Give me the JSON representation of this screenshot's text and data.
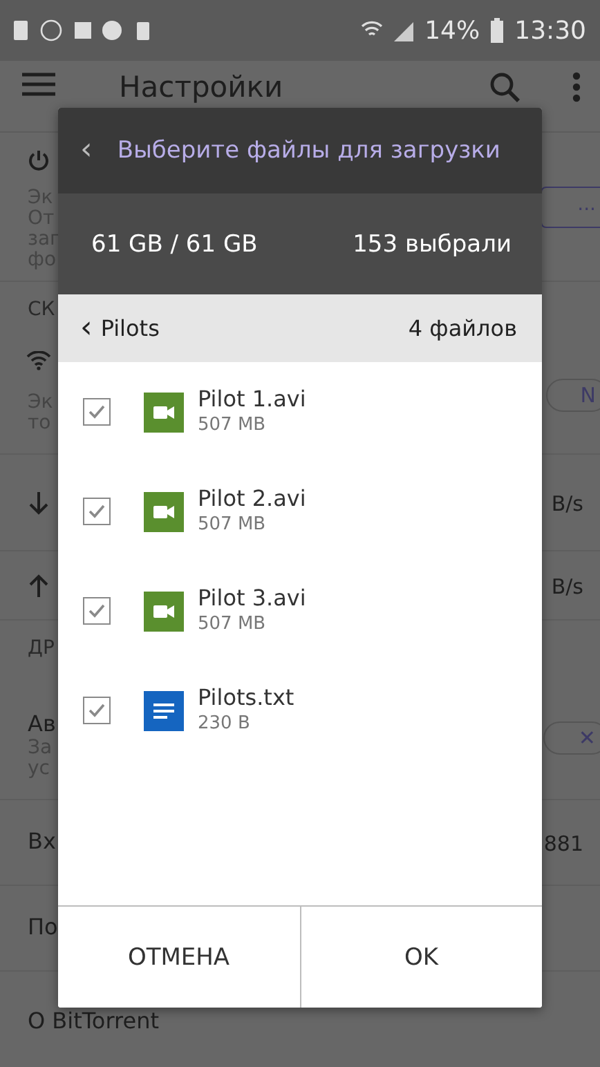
{
  "status_bar": {
    "battery": "14%",
    "time": "13:30"
  },
  "app_bar": {
    "title": "Настройки"
  },
  "settings": [
    {
      "kind": "row",
      "lines": [
        "Эк",
        "От",
        "заг",
        "фо"
      ],
      "trailing": {
        "kind": "outline",
        "text": "..."
      }
    },
    {
      "kind": "section",
      "lines": [
        "СК"
      ]
    },
    {
      "kind": "row",
      "lines": [
        "Эк",
        "то"
      ],
      "trailing": {
        "kind": "pill",
        "text": "N"
      }
    },
    {
      "kind": "row",
      "trailing": {
        "kind": "text",
        "text": "B/s"
      }
    },
    {
      "kind": "row",
      "trailing": {
        "kind": "text",
        "text": "B/s"
      }
    },
    {
      "kind": "section",
      "lines": [
        "ДР"
      ]
    },
    {
      "kind": "row",
      "lines": [
        "Ав",
        "За",
        "ус"
      ],
      "trailing": {
        "kind": "pill",
        "text": "✕"
      }
    },
    {
      "kind": "row",
      "lines": [
        "Вх"
      ],
      "trailing": {
        "kind": "text",
        "text": "881"
      }
    },
    {
      "kind": "row",
      "lines": [
        "По"
      ]
    },
    {
      "kind": "row",
      "lines": [
        "О BitTorrent"
      ]
    }
  ],
  "dialog": {
    "back": "‹",
    "title": "Выберите файлы для загрузки",
    "size": "61 GB / 61 GB",
    "selected_count": "153 выбрали",
    "folder": {
      "back": "‹",
      "name": "Pilots",
      "count": "4 файлов"
    },
    "files": [
      {
        "kind": "video",
        "name": "Pilot 1.avi",
        "size": "507 MB",
        "checked": true
      },
      {
        "kind": "video",
        "name": "Pilot 2.avi",
        "size": "507 MB",
        "checked": true
      },
      {
        "kind": "video",
        "name": "Pilot 3.avi",
        "size": "507 MB",
        "checked": true
      },
      {
        "kind": "text",
        "name": "Pilots.txt",
        "size": "230 B",
        "checked": true
      }
    ],
    "buttons": [
      "ОТМЕНА",
      "OK"
    ]
  }
}
